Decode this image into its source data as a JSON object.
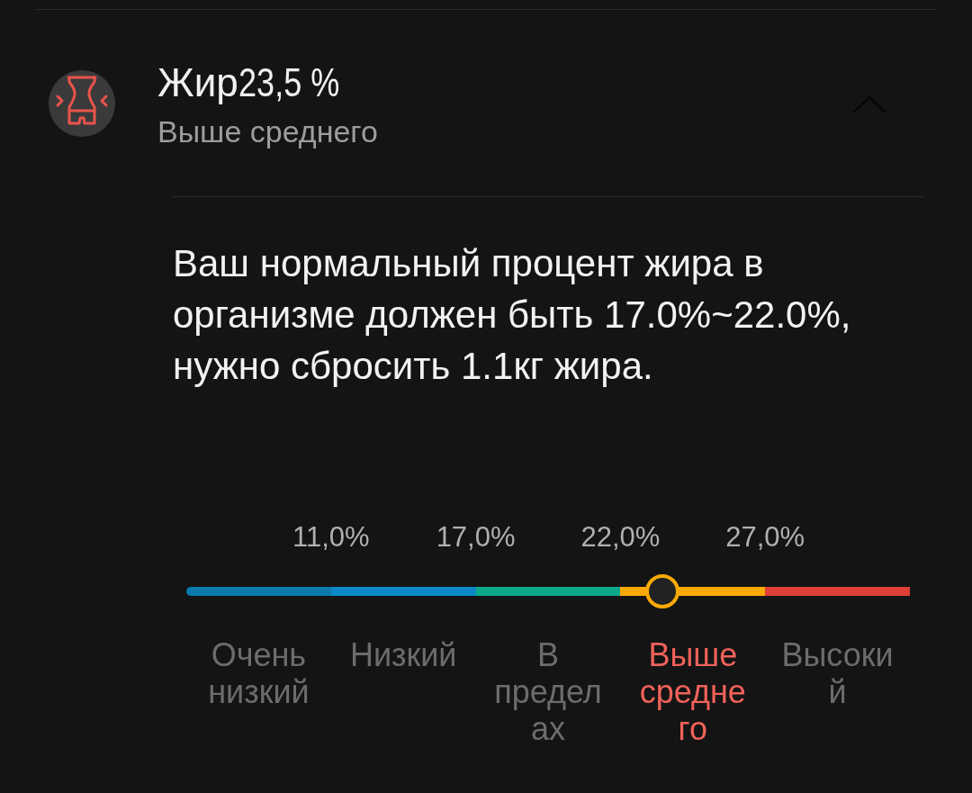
{
  "header": {
    "title": "Жир",
    "value": "23,5 %",
    "status": "Выше среднего",
    "expanded": true
  },
  "description": "Ваш нормальный процент жира в организме должен быть 17.0%~22.0%, нужно сбросить 1.1кг жира.",
  "scale": {
    "ticks": [
      "11,0%",
      "17,0%",
      "22,0%",
      "27,0%"
    ],
    "level": 0.658,
    "segments": [
      {
        "label": "Очень низкий",
        "color": "#0a7aad",
        "selected": false
      },
      {
        "label": "Низкий",
        "color": "#0b89c6",
        "selected": false
      },
      {
        "label": "В пределах",
        "color": "#0aa98a",
        "selected": false
      },
      {
        "label": "Выше среднего",
        "color": "#fba905",
        "selected": true
      },
      {
        "label": "Высокий",
        "color": "#de3f37",
        "selected": false
      }
    ]
  }
}
